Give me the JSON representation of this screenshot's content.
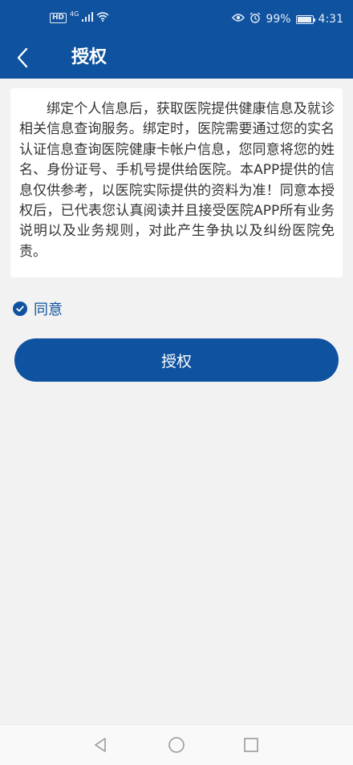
{
  "status_bar": {
    "hd": "HD",
    "network": "4G",
    "battery": "99%",
    "battery_level": 0.99,
    "time": "4:31"
  },
  "header": {
    "title": "授权"
  },
  "notice": {
    "text": "绑定个人信息后，获取医院提供健康信息及就诊相关信息查询服务。绑定时，医院需要通过您的实名认证信息查询医院健康卡帐户信息，您同意将您的姓名、身份证号、手机号提供给医院。本APP提供的信息仅供参考，以医院实际提供的资料为准！同意本授权后，已代表您认真阅读并且接受医院APP所有业务说明以及业务规则，对此产生争执以及纠纷医院免责。"
  },
  "agree": {
    "label": "同意",
    "checked": true
  },
  "buttons": {
    "authorize_label": "授权"
  },
  "colors": {
    "brand": "#0f529f",
    "background": "#f2f2f2"
  },
  "icons": {
    "back": "chevron-left-icon",
    "check": "check-circle-icon",
    "nav_back": "triangle-back-icon",
    "nav_home": "circle-home-icon",
    "nav_recent": "square-recent-icon"
  }
}
